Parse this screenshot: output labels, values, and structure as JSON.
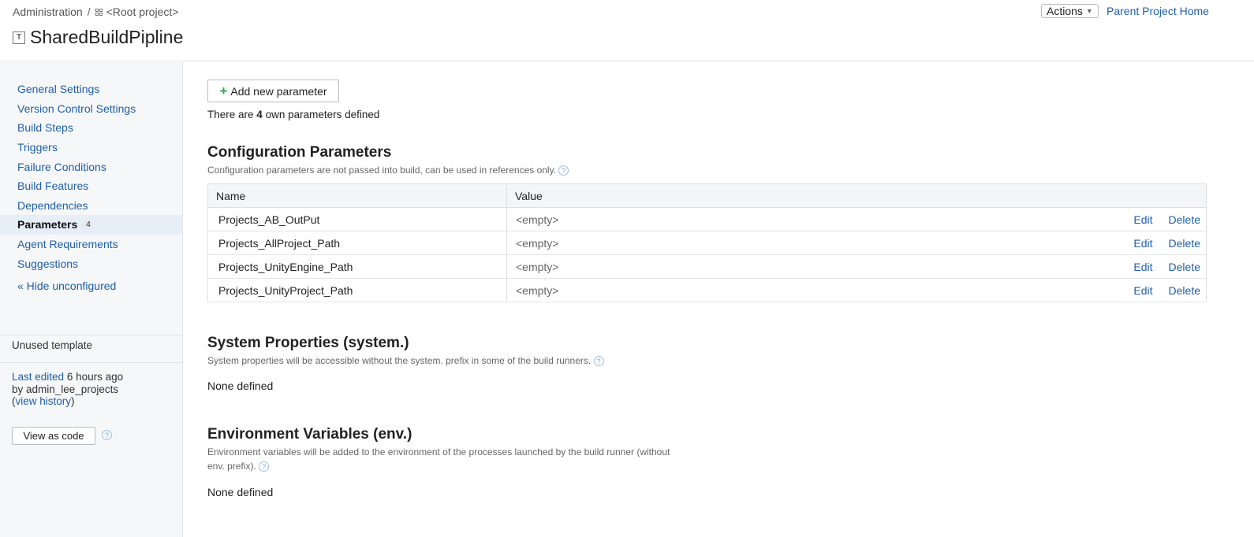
{
  "breadcrumb": {
    "admin": "Administration",
    "separator": "/",
    "root": "<Root project>"
  },
  "page": {
    "title_icon": "T",
    "title": "SharedBuildPipline"
  },
  "header": {
    "actions_label": "Actions",
    "parent_link": "Parent Project Home"
  },
  "sidebar": {
    "items": [
      {
        "label": "General Settings"
      },
      {
        "label": "Version Control Settings"
      },
      {
        "label": "Build Steps"
      },
      {
        "label": "Triggers"
      },
      {
        "label": "Failure Conditions"
      },
      {
        "label": "Build Features"
      },
      {
        "label": "Dependencies"
      },
      {
        "label": "Parameters",
        "badge": "4",
        "active": true
      },
      {
        "label": "Agent Requirements"
      },
      {
        "label": "Suggestions"
      }
    ],
    "hide_link": "« Hide unconfigured",
    "template_status": "Unused template",
    "last_edited_label": "Last edited",
    "last_edited_time": "6 hours ago",
    "edited_by": "by admin_lee_projects",
    "view_history": "view history",
    "view_as_code": "View as code"
  },
  "main": {
    "add_button": "Add new parameter",
    "count_prefix": "There are",
    "count": "4",
    "count_suffix": "own parameters defined",
    "config": {
      "heading": "Configuration Parameters",
      "description": "Configuration parameters are not passed into build, can be used in references only.",
      "columns": [
        "Name",
        "Value"
      ],
      "edit_label": "Edit",
      "delete_label": "Delete",
      "rows": [
        {
          "name": "Projects_AB_OutPut",
          "value": "<empty>"
        },
        {
          "name": "Projects_AllProject_Path",
          "value": "<empty>"
        },
        {
          "name": "Projects_UnityEngine_Path",
          "value": "<empty>"
        },
        {
          "name": "Projects_UnityProject_Path",
          "value": "<empty>"
        }
      ]
    },
    "system": {
      "heading": "System Properties (system.)",
      "description": "System properties will be accessible without the system. prefix in some of the build runners.",
      "empty": "None defined"
    },
    "env": {
      "heading": "Environment Variables (env.)",
      "description_line1": "Environment variables will be added to the environment of the processes launched by the build runner (without",
      "description_line2": "env. prefix).",
      "empty": "None defined"
    }
  },
  "icons": {
    "help": "?",
    "plus": "+",
    "caret": "▼"
  }
}
